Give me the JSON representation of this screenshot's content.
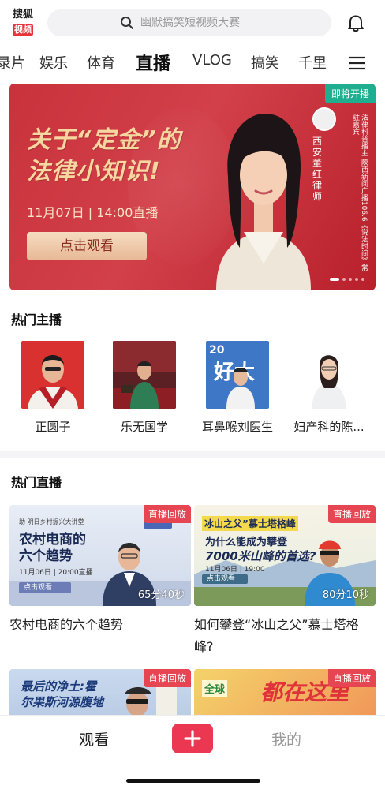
{
  "header": {
    "logo_line1": "搜狐",
    "logo_line2": "视频",
    "search_placeholder": "幽默搞笑短视频大赛"
  },
  "tabs": [
    "录片",
    "娱乐",
    "体育",
    "直播",
    "VLOG",
    "搞笑",
    "千里"
  ],
  "active_tab": "直播",
  "banner": {
    "badge": "即将开播",
    "headline_line1": "关于“定金”的",
    "headline_line2": "法律小知识!",
    "date_text": "11月07日 | 14:00直播",
    "button_label": "点击观看",
    "host_name": "西安董红律师",
    "host_desc": "法律科普播主 陕西新闻广播106.6《说法时间》常驻嘉宾"
  },
  "hot_anchors": {
    "title": "热门主播",
    "items": [
      {
        "name": "正圆子"
      },
      {
        "name": "乐无国学"
      },
      {
        "name": "耳鼻喉刘医生"
      },
      {
        "name": "妇产科的陈..."
      }
    ]
  },
  "hot_live": {
    "title": "热门直播",
    "cards": [
      {
        "tag": "直播回放",
        "duration": "65分40秒",
        "title": "农村电商的六个趋势",
        "thumb_line1": "农村电商的",
        "thumb_line2": "六个趋势",
        "thumb_small": "11月06日 | 20:00直播",
        "thumb_btn": "点击观看",
        "thumb_top": "助 明日乡村振兴大讲堂"
      },
      {
        "tag": "直播回放",
        "duration": "80分10秒",
        "title": "如何攀登“冰山之父”慕士塔格峰?",
        "thumb_line1": "冰山之父”慕士塔格峰",
        "thumb_line2": "为什么能成为攀登",
        "thumb_line3": "7000米山峰的首选?",
        "thumb_small": "11月06日 | 19:00",
        "thumb_btn": "点击观看"
      },
      {
        "tag": "直播回放",
        "thumb_line1": "最后的净土:霍",
        "thumb_line2": "尔果斯河源腹地"
      },
      {
        "tag": "直播回放",
        "thumb_line1": "全球",
        "thumb_line2": "都在这里"
      }
    ]
  },
  "bottom_nav": {
    "watch": "观看",
    "mine": "我的"
  },
  "colors": {
    "accent": "#ec3752",
    "banner_red": "#c9323b",
    "badge_green": "#1fae8f",
    "replay_tag": "#e64552"
  }
}
